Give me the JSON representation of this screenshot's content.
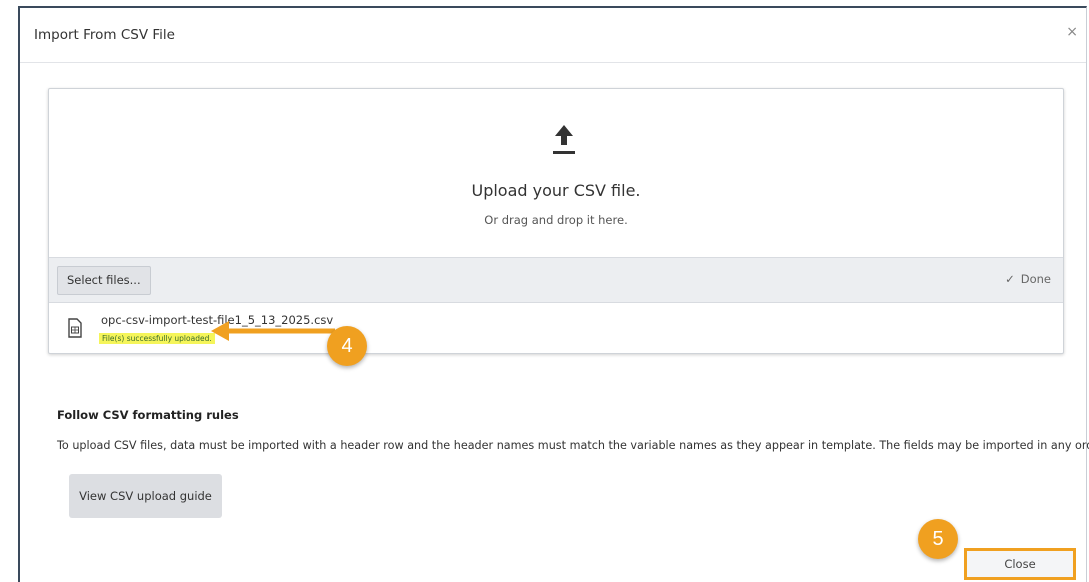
{
  "dialog": {
    "title": "Import From CSV File",
    "close_glyph": "×"
  },
  "upload": {
    "icon": "upload-icon",
    "title": "Upload your CSV file.",
    "subtitle": "Or drag and drop it here.",
    "select_button": "Select files...",
    "done_label": "Done",
    "done_icon": "check-icon"
  },
  "file": {
    "icon": "csv-file-icon",
    "name": "opc-csv-import-test-file1_5_13_2025.csv",
    "status": "File(s) successfully uploaded."
  },
  "annotations": {
    "step4": "4",
    "step5": "5",
    "accent": "#f0a020"
  },
  "rules": {
    "title": "Follow CSV formatting rules",
    "text": "To upload CSV files, data must be imported with a header row and the header names must match the variable names as they appear in template. The fields may be imported in any order.",
    "guide_button": "View CSV upload guide"
  },
  "footer": {
    "close_button": "Close"
  }
}
